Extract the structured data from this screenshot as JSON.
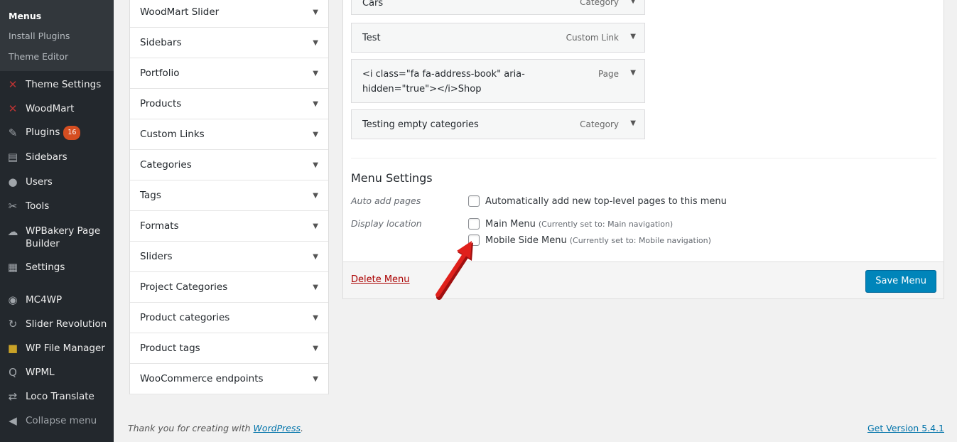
{
  "sidebar": {
    "submenu": [
      {
        "label": "Menus",
        "current": true
      },
      {
        "label": "Install Plugins"
      },
      {
        "label": "Theme Editor"
      }
    ],
    "items": [
      {
        "label": "Theme Settings",
        "icon": "theme-settings-icon"
      },
      {
        "label": "WoodMart",
        "icon": "woodmart-icon"
      },
      {
        "label": "Plugins",
        "icon": "plugin-icon",
        "badge": "16"
      },
      {
        "label": "Sidebars",
        "icon": "sidebars-icon"
      },
      {
        "label": "Users",
        "icon": "users-icon"
      },
      {
        "label": "Tools",
        "icon": "tools-icon"
      },
      {
        "label": "WPBakery Page Builder",
        "icon": "wpbakery-icon"
      },
      {
        "label": "Settings",
        "icon": "settings-icon"
      },
      {
        "label": "MC4WP",
        "icon": "mc4wp-icon"
      },
      {
        "label": "Slider Revolution",
        "icon": "slider-revolution-icon"
      },
      {
        "label": "WP File Manager",
        "icon": "folder-icon"
      },
      {
        "label": "WPML",
        "icon": "wpml-icon"
      },
      {
        "label": "Loco Translate",
        "icon": "translate-icon"
      },
      {
        "label": "Collapse menu",
        "icon": "collapse-icon"
      }
    ]
  },
  "accordion": {
    "items": [
      "WoodMart Slider",
      "Sidebars",
      "Portfolio",
      "Products",
      "Custom Links",
      "Categories",
      "Tags",
      "Formats",
      "Sliders",
      "Project Categories",
      "Product categories",
      "Product tags",
      "WooCommerce endpoints"
    ]
  },
  "menu_items": [
    {
      "title": "Cars",
      "type": "Category"
    },
    {
      "title": "Test",
      "type": "Custom Link"
    },
    {
      "title": "<i class=\"fa fa-address-book\" aria-hidden=\"true\"></i>Shop",
      "type": "Page"
    },
    {
      "title": "Testing empty categories",
      "type": "Category"
    }
  ],
  "menu_settings": {
    "title": "Menu Settings",
    "auto_add_label": "Auto add pages",
    "auto_add_text": "Automatically add new top-level pages to this menu",
    "display_location_label": "Display location",
    "locations": [
      {
        "label": "Main Menu",
        "note": "(Currently set to: Main navigation)"
      },
      {
        "label": "Mobile Side Menu",
        "note": "(Currently set to: Mobile navigation)"
      }
    ]
  },
  "actions": {
    "delete": "Delete Menu",
    "save": "Save Menu"
  },
  "footer": {
    "thanks_prefix": "Thank you for creating with ",
    "thanks_link": "WordPress",
    "thanks_suffix": ".",
    "version": "Get Version 5.4.1"
  },
  "colors": {
    "sidebar_bg": "#23282d",
    "primary_button": "#0085ba",
    "delete_link": "#aa0000",
    "badge": "#d54e21",
    "annotation_arrow": "#e0201b"
  }
}
